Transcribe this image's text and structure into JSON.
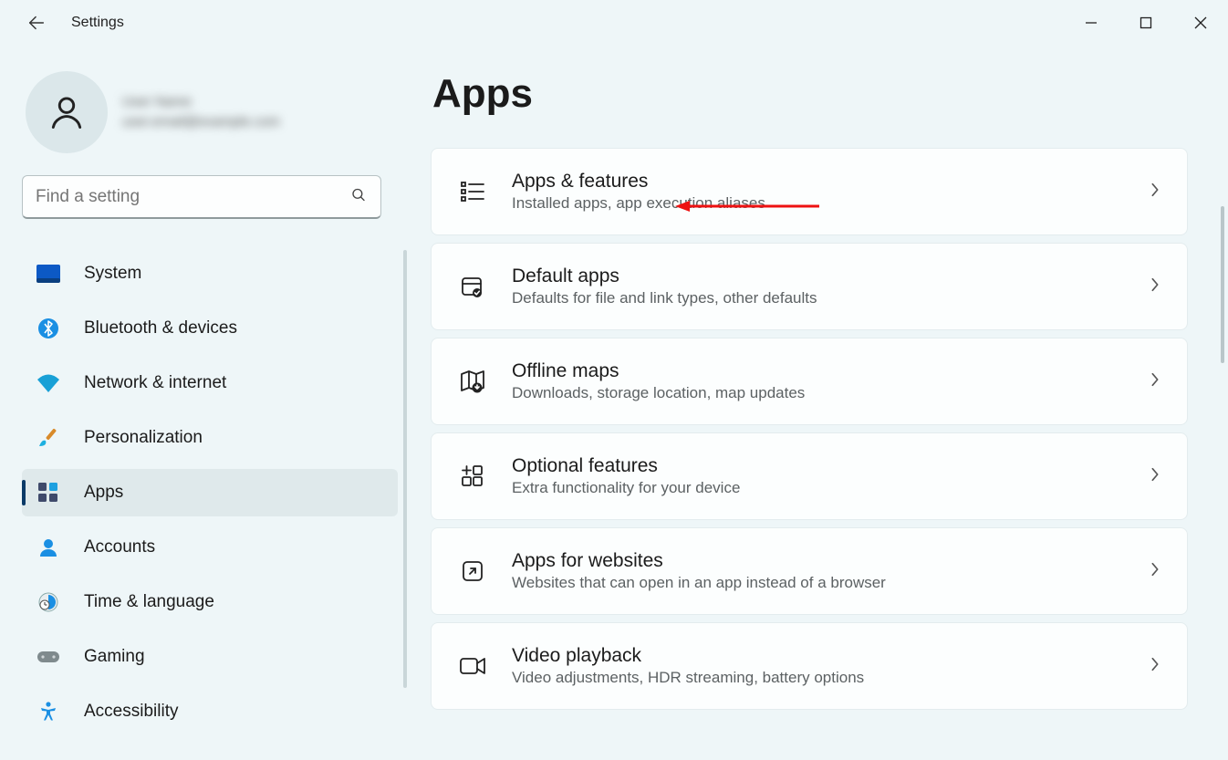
{
  "app": {
    "title": "Settings"
  },
  "profile": {
    "name": "User Name",
    "email": "user.email@example.com"
  },
  "search": {
    "placeholder": "Find a setting"
  },
  "sidebar": {
    "items": [
      {
        "label": "System"
      },
      {
        "label": "Bluetooth & devices"
      },
      {
        "label": "Network & internet"
      },
      {
        "label": "Personalization"
      },
      {
        "label": "Apps"
      },
      {
        "label": "Accounts"
      },
      {
        "label": "Time & language"
      },
      {
        "label": "Gaming"
      },
      {
        "label": "Accessibility"
      }
    ],
    "active_index": 4
  },
  "page": {
    "title": "Apps"
  },
  "cards": [
    {
      "title": "Apps & features",
      "desc": "Installed apps, app execution aliases"
    },
    {
      "title": "Default apps",
      "desc": "Defaults for file and link types, other defaults"
    },
    {
      "title": "Offline maps",
      "desc": "Downloads, storage location, map updates"
    },
    {
      "title": "Optional features",
      "desc": "Extra functionality for your device"
    },
    {
      "title": "Apps for websites",
      "desc": "Websites that can open in an app instead of a browser"
    },
    {
      "title": "Video playback",
      "desc": "Video adjustments, HDR streaming, battery options"
    }
  ]
}
